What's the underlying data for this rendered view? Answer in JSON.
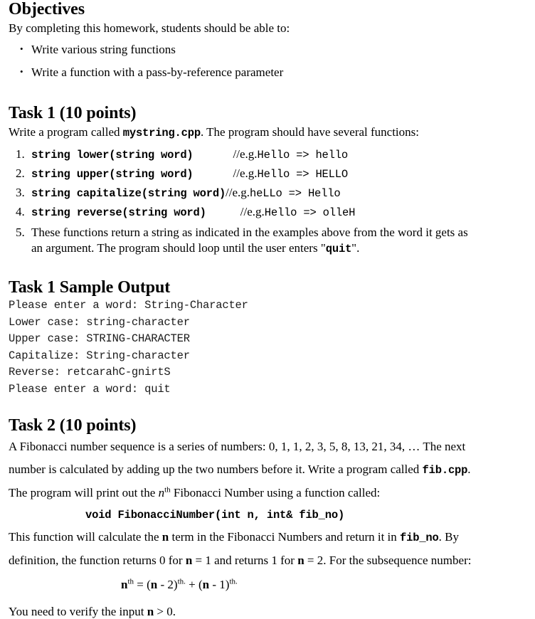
{
  "objectives": {
    "heading": "Objectives",
    "intro": "By completing this homework, students should be able to:",
    "bullets": [
      "Write various string functions",
      "Write a function with a pass-by-reference parameter"
    ]
  },
  "task1": {
    "heading": "Task 1 (10 points)",
    "intro_before": "Write a program called ",
    "intro_code": "mystring.cpp",
    "intro_after": ".  The program should have several functions:",
    "items": [
      {
        "num": "1.",
        "signature": "string lower(string word)",
        "comment_slash": "//",
        "comment_eg": "e.g.",
        "comment_code": "Hello => hello"
      },
      {
        "num": "2.",
        "signature": "string upper(string word)",
        "comment_slash": "//",
        "comment_eg": "e.g.",
        "comment_code": "Hello => HELLO"
      },
      {
        "num": "3.",
        "signature": "string capitalize(string word)",
        "comment_slash": "//",
        "comment_eg": "e.g.",
        "comment_code": "heLLo => Hello"
      },
      {
        "num": "4.",
        "signature": "string reverse(string word)",
        "comment_slash": "//",
        "comment_eg": "e.g.",
        "comment_code": "Hello => olleH"
      }
    ],
    "item5": {
      "num": "5.",
      "line1": "These functions return a string as indicated in the examples above from the word it gets as",
      "line2_before": "an argument.  The program should loop until the user enters \"",
      "line2_code": "quit",
      "line2_after": "\"."
    }
  },
  "sample_output": {
    "heading": "Task 1 Sample Output",
    "lines": [
      "Please enter a word: String-Character",
      "Lower case: string-character",
      "Upper case: STRING-CHARACTER",
      "Capitalize: String-character",
      "Reverse: retcarahC-gnirtS",
      "Please enter a word: quit"
    ]
  },
  "task2": {
    "heading": "Task 2 (10 points)",
    "p1_line1": "A Fibonacci number sequence is a series of numbers: 0, 1, 1, 2, 3, 5, 8, 13, 21, 34, …  The next",
    "p1_line2_before": "number is calculated by adding up the two numbers before it. Write a program called ",
    "p1_line2_code": "fib.cpp",
    "p1_line2_after": ".",
    "p1_line3_before": "The program will print out the ",
    "p1_line3_n": "n",
    "p1_line3_sup": "th",
    "p1_line3_after": " Fibonacci Number using a function called:",
    "signature": "void FibonacciNumber(int n, int& fib_no)",
    "p2_a": "This function will calculate the ",
    "p2_n1": "n",
    "p2_b": " term in the Fibonacci Numbers and return it in ",
    "p2_code": "fib_no",
    "p2_c": ".  By",
    "p3_a": "definition, the function returns 0 for ",
    "p3_n1": "n",
    "p3_b": " = 1 and returns 1 for ",
    "p3_n2": "n",
    "p3_c": " = 2.  For the subsequence number:",
    "formula": {
      "n1": "n",
      "sup1": "th",
      "eq": " = (",
      "n2": "n",
      "minus2": " - 2)",
      "sup2": "th.",
      "plus": " + (",
      "n3": "n",
      "minus1": " - 1)",
      "sup3": "th."
    },
    "verify_a": "You need to verify the input ",
    "verify_n": "n",
    "verify_b": " > 0."
  }
}
